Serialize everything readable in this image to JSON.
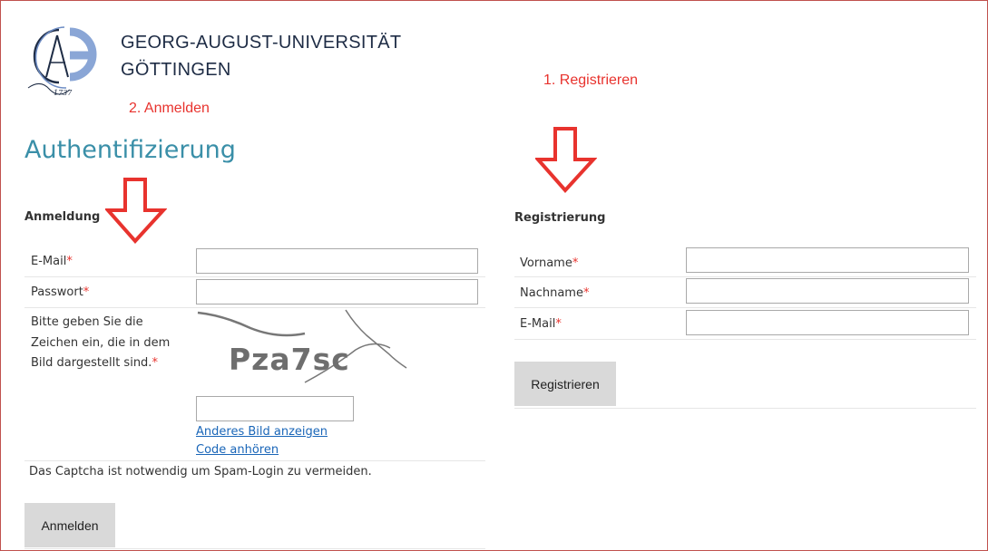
{
  "header": {
    "university_line1": "GEORG-AUGUST-UNIVERSITÄT",
    "university_line2": "GÖTTINGEN",
    "logo_year": "1737",
    "logo_icon": "university-seal-icon"
  },
  "annotations": {
    "step_login": "2. Anmelden",
    "step_register": "1. Registrieren",
    "arrow_color": "#e8332e"
  },
  "page": {
    "title": "Authentifizierung"
  },
  "login": {
    "heading": "Anmeldung",
    "email_label": "E-Mail",
    "email_value": "",
    "password_label": "Passwort",
    "password_value": "",
    "required_marker": "*",
    "captcha_help": "Bitte geben Sie die Zeichen ein, die in dem Bild dargestellt sind.",
    "captcha_image_text": "Pza7sc",
    "captcha_value": "",
    "other_image_link": "Anderes Bild anzeigen",
    "listen_code_link": "Code anhören",
    "captcha_note": "Das Captcha ist notwendig um Spam-Login zu vermeiden.",
    "submit_label": "Anmelden"
  },
  "register": {
    "heading": "Registrierung",
    "firstname_label": "Vorname",
    "firstname_value": "",
    "lastname_label": "Nachname",
    "lastname_value": "",
    "email_label": "E-Mail",
    "email_value": "",
    "required_marker": "*",
    "submit_label": "Registrieren"
  },
  "colors": {
    "title": "#3a8fa8",
    "required": "#e8332e",
    "link": "#1a66b8",
    "button_bg": "#d9d9d9",
    "frame_border": "#c0504d"
  }
}
